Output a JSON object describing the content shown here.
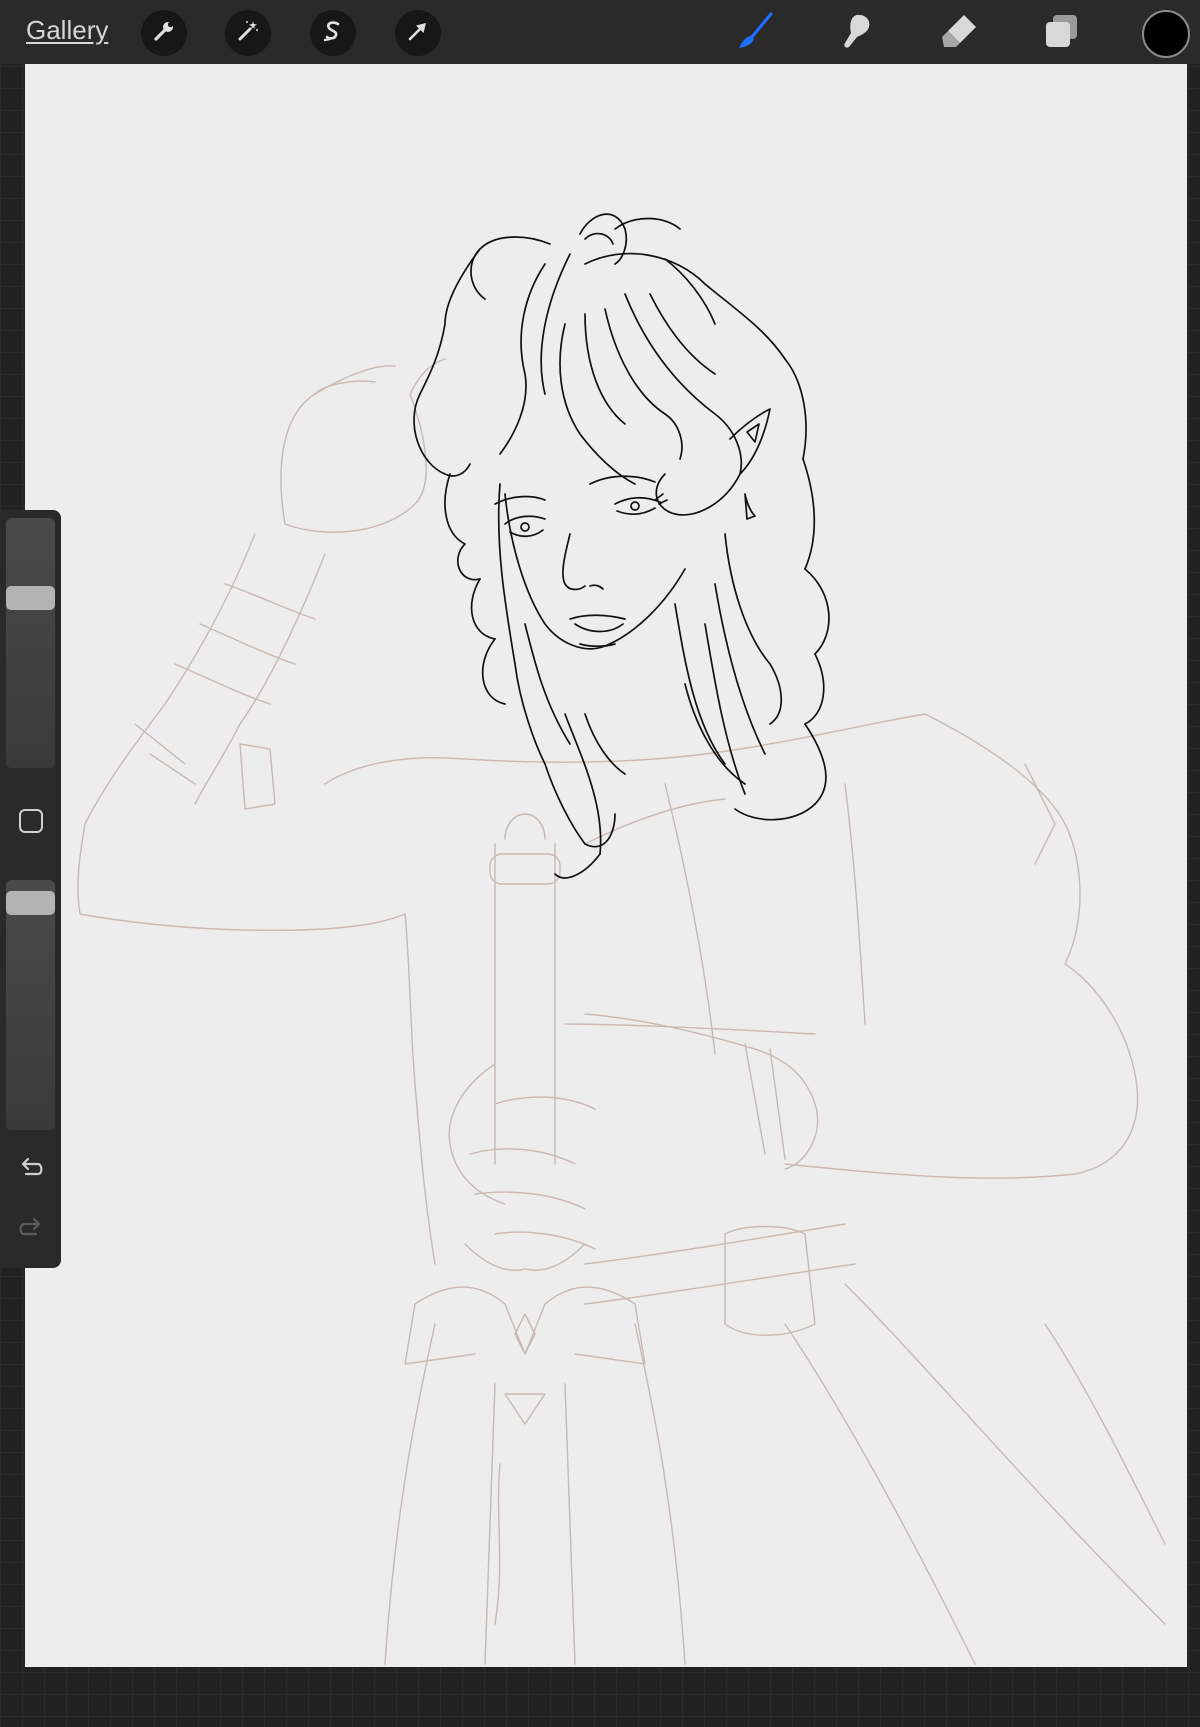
{
  "topbar": {
    "gallery_label": "Gallery",
    "left_tools": [
      {
        "name": "actions",
        "icon": "wrench-icon"
      },
      {
        "name": "adjustments",
        "icon": "magic-wand-icon"
      },
      {
        "name": "selection",
        "icon": "selection-s-icon"
      },
      {
        "name": "transform",
        "icon": "arrow-cursor-icon"
      }
    ],
    "right_tools": [
      {
        "name": "brush",
        "icon": "brush-icon",
        "active": true
      },
      {
        "name": "smudge",
        "icon": "smudge-finger-icon",
        "active": false
      },
      {
        "name": "eraser",
        "icon": "eraser-icon",
        "active": false
      },
      {
        "name": "layers",
        "icon": "layers-icon",
        "active": false
      }
    ],
    "current_color": "#000000"
  },
  "sidebar": {
    "brush_size_level": 0.7,
    "opacity_level": 0.95,
    "modify_button_icon": "square-icon",
    "undo_icon": "undo-icon",
    "redo_icon": "redo-icon"
  },
  "colors": {
    "accent": "#1e6fff",
    "canvas": "#ededed",
    "ink": "#111111",
    "sketch": "#c9b9b3"
  }
}
